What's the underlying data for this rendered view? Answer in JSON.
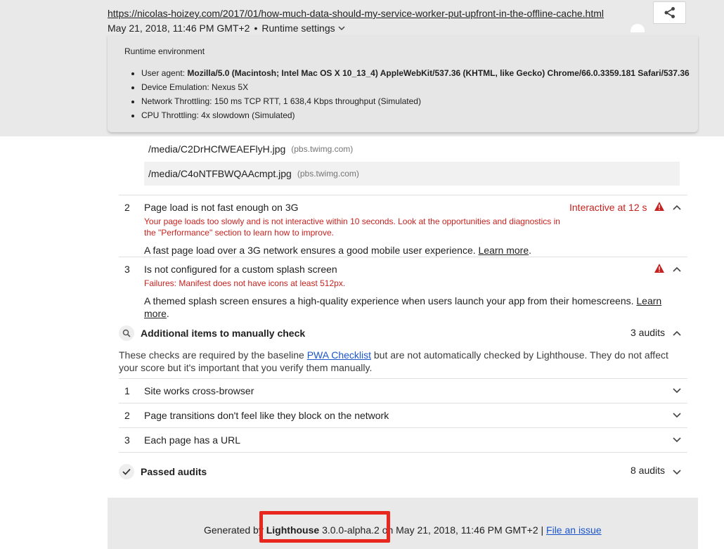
{
  "header": {
    "url": "https://nicolas-hoizey.com/2017/01/how-much-data-should-my-service-worker-put-upfront-in-the-offline-cache.html",
    "timestamp": "May 21, 2018, 11:46 PM GMT+2",
    "separator": "•",
    "runtime_settings_label": "Runtime settings",
    "share_icon": "share-icon"
  },
  "runtime": {
    "title": "Runtime environment",
    "user_agent_label": "User agent:",
    "user_agent_value": "Mozilla/5.0 (Macintosh; Intel Mac OS X 10_13_4) AppleWebKit/537.36 (KHTML, like Gecko) Chrome/66.0.3359.181 Safari/537.36",
    "device_emulation": "Device Emulation: Nexus 5X",
    "network_throttling": "Network Throttling: 150 ms TCP RTT, 1 638,4 Kbps throughput (Simulated)",
    "cpu_throttling": "CPU Throttling: 4x slowdown (Simulated)"
  },
  "urls": [
    {
      "path": "/media/C2DrHCfWEAEFlyH.jpg",
      "host": "(pbs.twimg.com)"
    },
    {
      "path": "/media/C4oNTFBWQAAcmpt.jpg",
      "host": "(pbs.twimg.com)"
    }
  ],
  "failed_audits": [
    {
      "num": "2",
      "title": "Page load is not fast enough on 3G",
      "metric": "Interactive at 12 s",
      "failure_line1": "Your page loads too slowly and is not interactive within 10 seconds. Look at the opportunities and diagnostics in",
      "failure_line2": "the \"Performance\" section to learn how to improve.",
      "desc": "A fast page load over a 3G network ensures a good mobile user experience.",
      "learn_more": "Learn more",
      "desc_end": "."
    },
    {
      "num": "3",
      "title": "Is not configured for a custom splash screen",
      "failure_line1": "Failures: Manifest does not have icons at least 512px.",
      "desc": "A themed splash screen ensures a high-quality experience when users launch your app from their homescreens.",
      "learn_more_1": "Learn",
      "learn_more_2": "more",
      "desc_end": "."
    }
  ],
  "manual": {
    "title": "Additional items to manually check",
    "count": "3 audits",
    "intro_before": "These checks are required by the baseline",
    "intro_link": "PWA Checklist",
    "intro_after": "but are not automatically checked by Lighthouse. They do not affect",
    "intro_line2": "your score but it's important that you verify them manually.",
    "items": [
      {
        "num": "1",
        "title": "Site works cross-browser"
      },
      {
        "num": "2",
        "title": "Page transitions don't feel like they block on the network"
      },
      {
        "num": "3",
        "title": "Each page has a URL"
      }
    ]
  },
  "passed": {
    "title": "Passed audits",
    "count": "8 audits"
  },
  "footer": {
    "generated_by": "Generated by",
    "product": "Lighthouse",
    "version": "3.0.0-alpha.2",
    "on_date": "on May 21, 2018, 11:46 PM GMT+2 |",
    "file_issue": "File an issue"
  },
  "colors": {
    "fail": "#c7221f",
    "highlight_box": "#e8281f",
    "link": "#1a55c9"
  }
}
